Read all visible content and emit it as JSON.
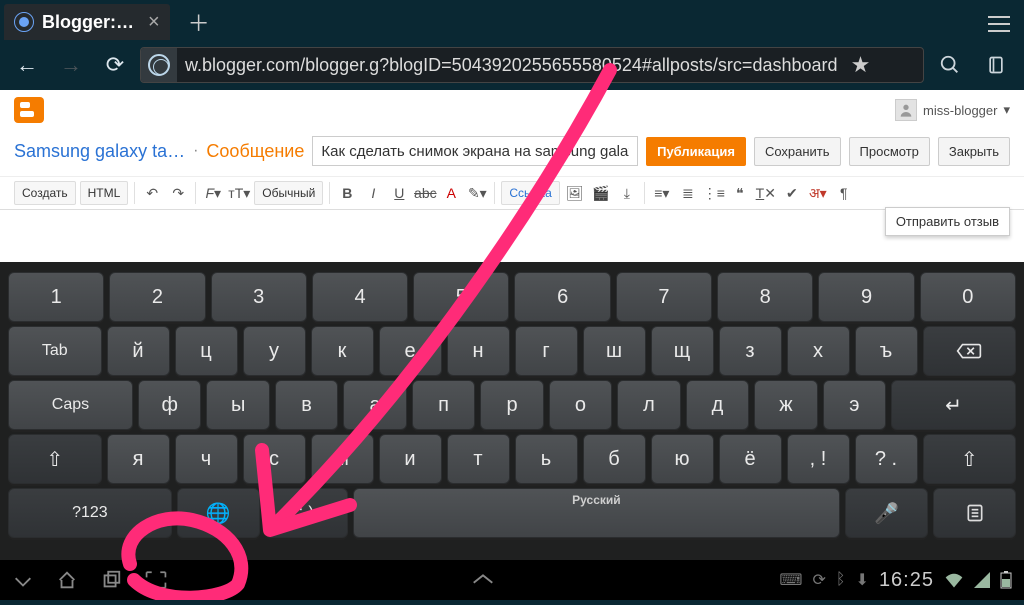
{
  "browser": {
    "tab_title": "Blogger:…",
    "url": "w.blogger.com/blogger.g?blogID=5043920255655580524#allposts/src=dashboard"
  },
  "page": {
    "user": "miss-blogger",
    "breadcrumb1": "Samsung galaxy ta…",
    "breadcrumb2": "Сообщение",
    "post_title": "Как сделать снимок экрана на samsung galaxy ta",
    "publish": "Публикация",
    "save": "Сохранить",
    "preview": "Просмотр",
    "close": "Закрыть",
    "tb_create": "Создать",
    "tb_html": "HTML",
    "tb_normal": "Обычный",
    "tb_link": "Ссылка",
    "feedback": "Отправить отзыв"
  },
  "kbd": {
    "row1": [
      "1",
      "2",
      "3",
      "4",
      "5",
      "6",
      "7",
      "8",
      "9",
      "0"
    ],
    "tab": "Tab",
    "row2": [
      "й",
      "ц",
      "у",
      "к",
      "е",
      "н",
      "г",
      "ш",
      "щ",
      "з",
      "х",
      "ъ"
    ],
    "caps": "Caps",
    "row3": [
      "ф",
      "ы",
      "в",
      "а",
      "п",
      "р",
      "о",
      "л",
      "д",
      "ж",
      "э"
    ],
    "row4": [
      "я",
      "ч",
      "с",
      "м",
      "и",
      "т",
      "ь",
      "б",
      "ю",
      "ё",
      ", !",
      "? ."
    ],
    "sym": "?123",
    "emoji": ":-)",
    "space_lang": "Русский"
  },
  "sys": {
    "time": "16:25"
  }
}
